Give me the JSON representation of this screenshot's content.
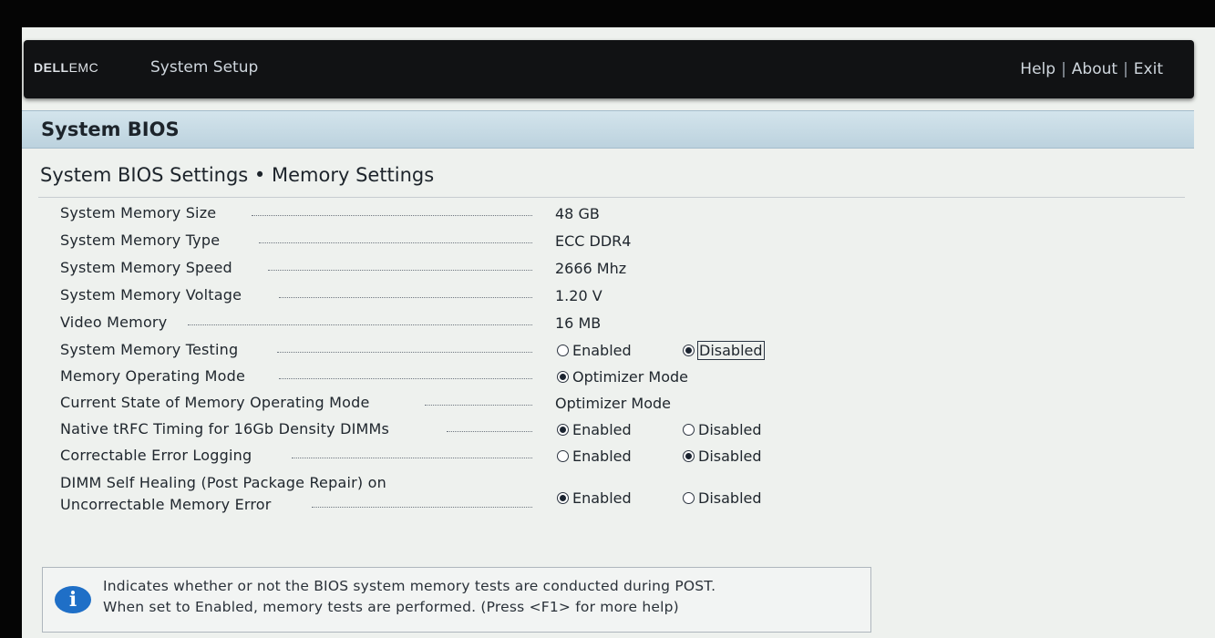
{
  "header": {
    "logo_bold": "DELL",
    "logo_rest": "EMC",
    "app_title": "System Setup",
    "links": [
      "Help",
      "About",
      "Exit"
    ],
    "separator": "|"
  },
  "panel": {
    "title": "System BIOS",
    "section_title": "System BIOS Settings • Memory Settings"
  },
  "settings": {
    "memory_size": {
      "label": "System Memory Size",
      "value": "48 GB"
    },
    "memory_type": {
      "label": "System Memory Type",
      "value": "ECC DDR4"
    },
    "memory_speed": {
      "label": "System Memory Speed",
      "value": "2666 Mhz"
    },
    "memory_voltage": {
      "label": "System Memory Voltage",
      "value": "1.20 V"
    },
    "video_memory": {
      "label": "Video Memory",
      "value": "16 MB"
    },
    "memory_testing": {
      "label": "System Memory Testing",
      "option_a": "Enabled",
      "option_b": "Disabled",
      "selected": "Disabled"
    },
    "operating_mode": {
      "label": "Memory Operating Mode",
      "option_a": "Optimizer Mode",
      "selected": "Optimizer Mode"
    },
    "current_mode": {
      "label": "Current State of Memory Operating Mode",
      "value": "Optimizer Mode"
    },
    "trfc_timing": {
      "label": "Native tRFC Timing for 16Gb Density DIMMs",
      "option_a": "Enabled",
      "option_b": "Disabled",
      "selected": "Enabled"
    },
    "error_logging": {
      "label": "Correctable Error Logging",
      "option_a": "Enabled",
      "option_b": "Disabled",
      "selected": "Disabled"
    },
    "self_healing": {
      "label_line1": "DIMM Self Healing (Post Package Repair) on",
      "label_line2": "Uncorrectable Memory Error",
      "option_a": "Enabled",
      "option_b": "Disabled",
      "selected": "Enabled"
    }
  },
  "help": {
    "icon": "info-icon",
    "icon_glyph": "i",
    "line1": "Indicates whether or not the BIOS system memory tests are conducted during POST.",
    "line2": "When set to Enabled, memory tests are performed. (Press <F1> for more help)"
  },
  "colors": {
    "topbar": "#111214",
    "panel_header": "#c6dae4",
    "info_icon": "#1f6fc7"
  }
}
